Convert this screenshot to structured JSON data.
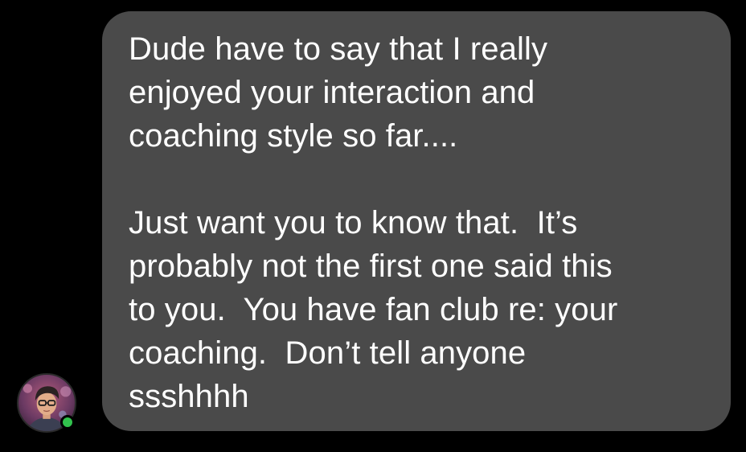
{
  "colors": {
    "background": "#000000",
    "bubble": "#4a4a4a",
    "text": "#ffffff",
    "presence": "#31c24d"
  },
  "sender": {
    "avatar_icon": "profile-photo",
    "status_icon": "online-dot"
  },
  "message": {
    "paragraph_1": [
      "Dude have to say that I really",
      "enjoyed your interaction and",
      "coaching style so far...."
    ],
    "paragraph_2": [
      "Just want you to know that.  It’s",
      "probably not the first one said this",
      "to you.  You have fan club re: your",
      "coaching.  Don’t tell anyone",
      "ssshhhh"
    ]
  }
}
